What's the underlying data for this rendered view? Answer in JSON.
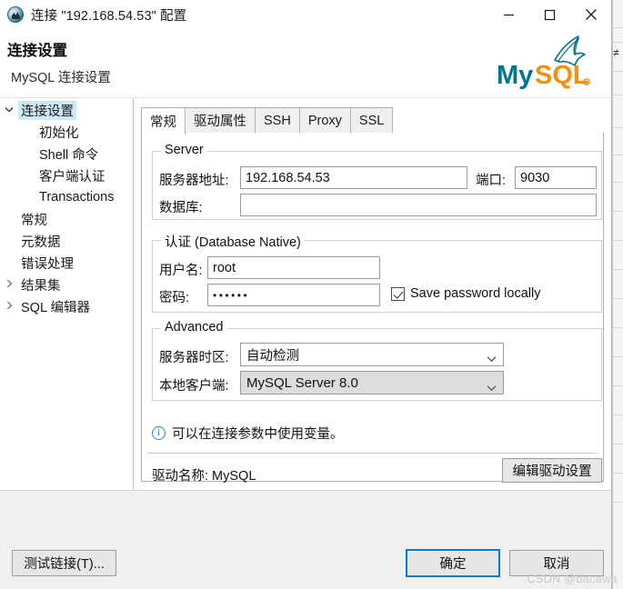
{
  "window": {
    "title": "连接 \"192.168.54.53\" 配置",
    "icon": "dbeaver-connection-icon",
    "controls": {
      "minimize": "minimize-icon",
      "maximize": "maximize-icon",
      "close": "close-icon"
    }
  },
  "header": {
    "title": "连接设置",
    "subtitle": "MySQL 连接设置",
    "logo_text_primary": "My",
    "logo_text_secondary": "SQL",
    "logo_primary_color": "#00758F",
    "logo_secondary_color": "#F29111"
  },
  "tree": {
    "items": [
      {
        "label": "连接设置",
        "level": 0,
        "twisty": "expanded",
        "selected": true
      },
      {
        "label": "初始化",
        "level": 1,
        "twisty": "none",
        "selected": false
      },
      {
        "label": "Shell 命令",
        "level": 1,
        "twisty": "none",
        "selected": false
      },
      {
        "label": "客户端认证",
        "level": 1,
        "twisty": "none",
        "selected": false
      },
      {
        "label": "Transactions",
        "level": 1,
        "twisty": "none",
        "selected": false
      },
      {
        "label": "常规",
        "level": 0,
        "twisty": "none",
        "selected": false
      },
      {
        "label": "元数据",
        "level": 0,
        "twisty": "none",
        "selected": false
      },
      {
        "label": "错误处理",
        "level": 0,
        "twisty": "none",
        "selected": false
      },
      {
        "label": "结果集",
        "level": 0,
        "twisty": "collapsed",
        "selected": false
      },
      {
        "label": "SQL 编辑器",
        "level": 0,
        "twisty": "collapsed",
        "selected": false
      }
    ]
  },
  "tabs": [
    {
      "label": "常规",
      "active": true
    },
    {
      "label": "驱动属性",
      "active": false
    },
    {
      "label": "SSH",
      "active": false
    },
    {
      "label": "Proxy",
      "active": false
    },
    {
      "label": "SSL",
      "active": false
    }
  ],
  "server_group": {
    "legend": "Server",
    "host_label": "服务器地址:",
    "host_value": "192.168.54.53",
    "port_label": "端口:",
    "port_value": "9030",
    "database_label": "数据库:",
    "database_value": ""
  },
  "auth_group": {
    "legend": "认证 (Database Native)",
    "username_label": "用户名:",
    "username_value": "root",
    "password_label": "密码:",
    "password_value": "••••••",
    "save_password_label": "Save password locally",
    "save_password_checked": true
  },
  "advanced_group": {
    "legend": "Advanced",
    "timezone_label": "服务器时区:",
    "timezone_value": "自动检测",
    "client_label": "本地客户端:",
    "client_value": "MySQL Server 8.0",
    "client_disabled": true
  },
  "info": {
    "icon": "info-circle-icon",
    "text": "可以在连接参数中使用变量。"
  },
  "driver": {
    "label": "驱动名称: MySQL",
    "edit_button": "编辑驱动设置"
  },
  "footer": {
    "test_button": "测试链接(T)...",
    "ok_button": "确定",
    "cancel_button": "取消"
  },
  "watermark": "CSDN @bacawa"
}
